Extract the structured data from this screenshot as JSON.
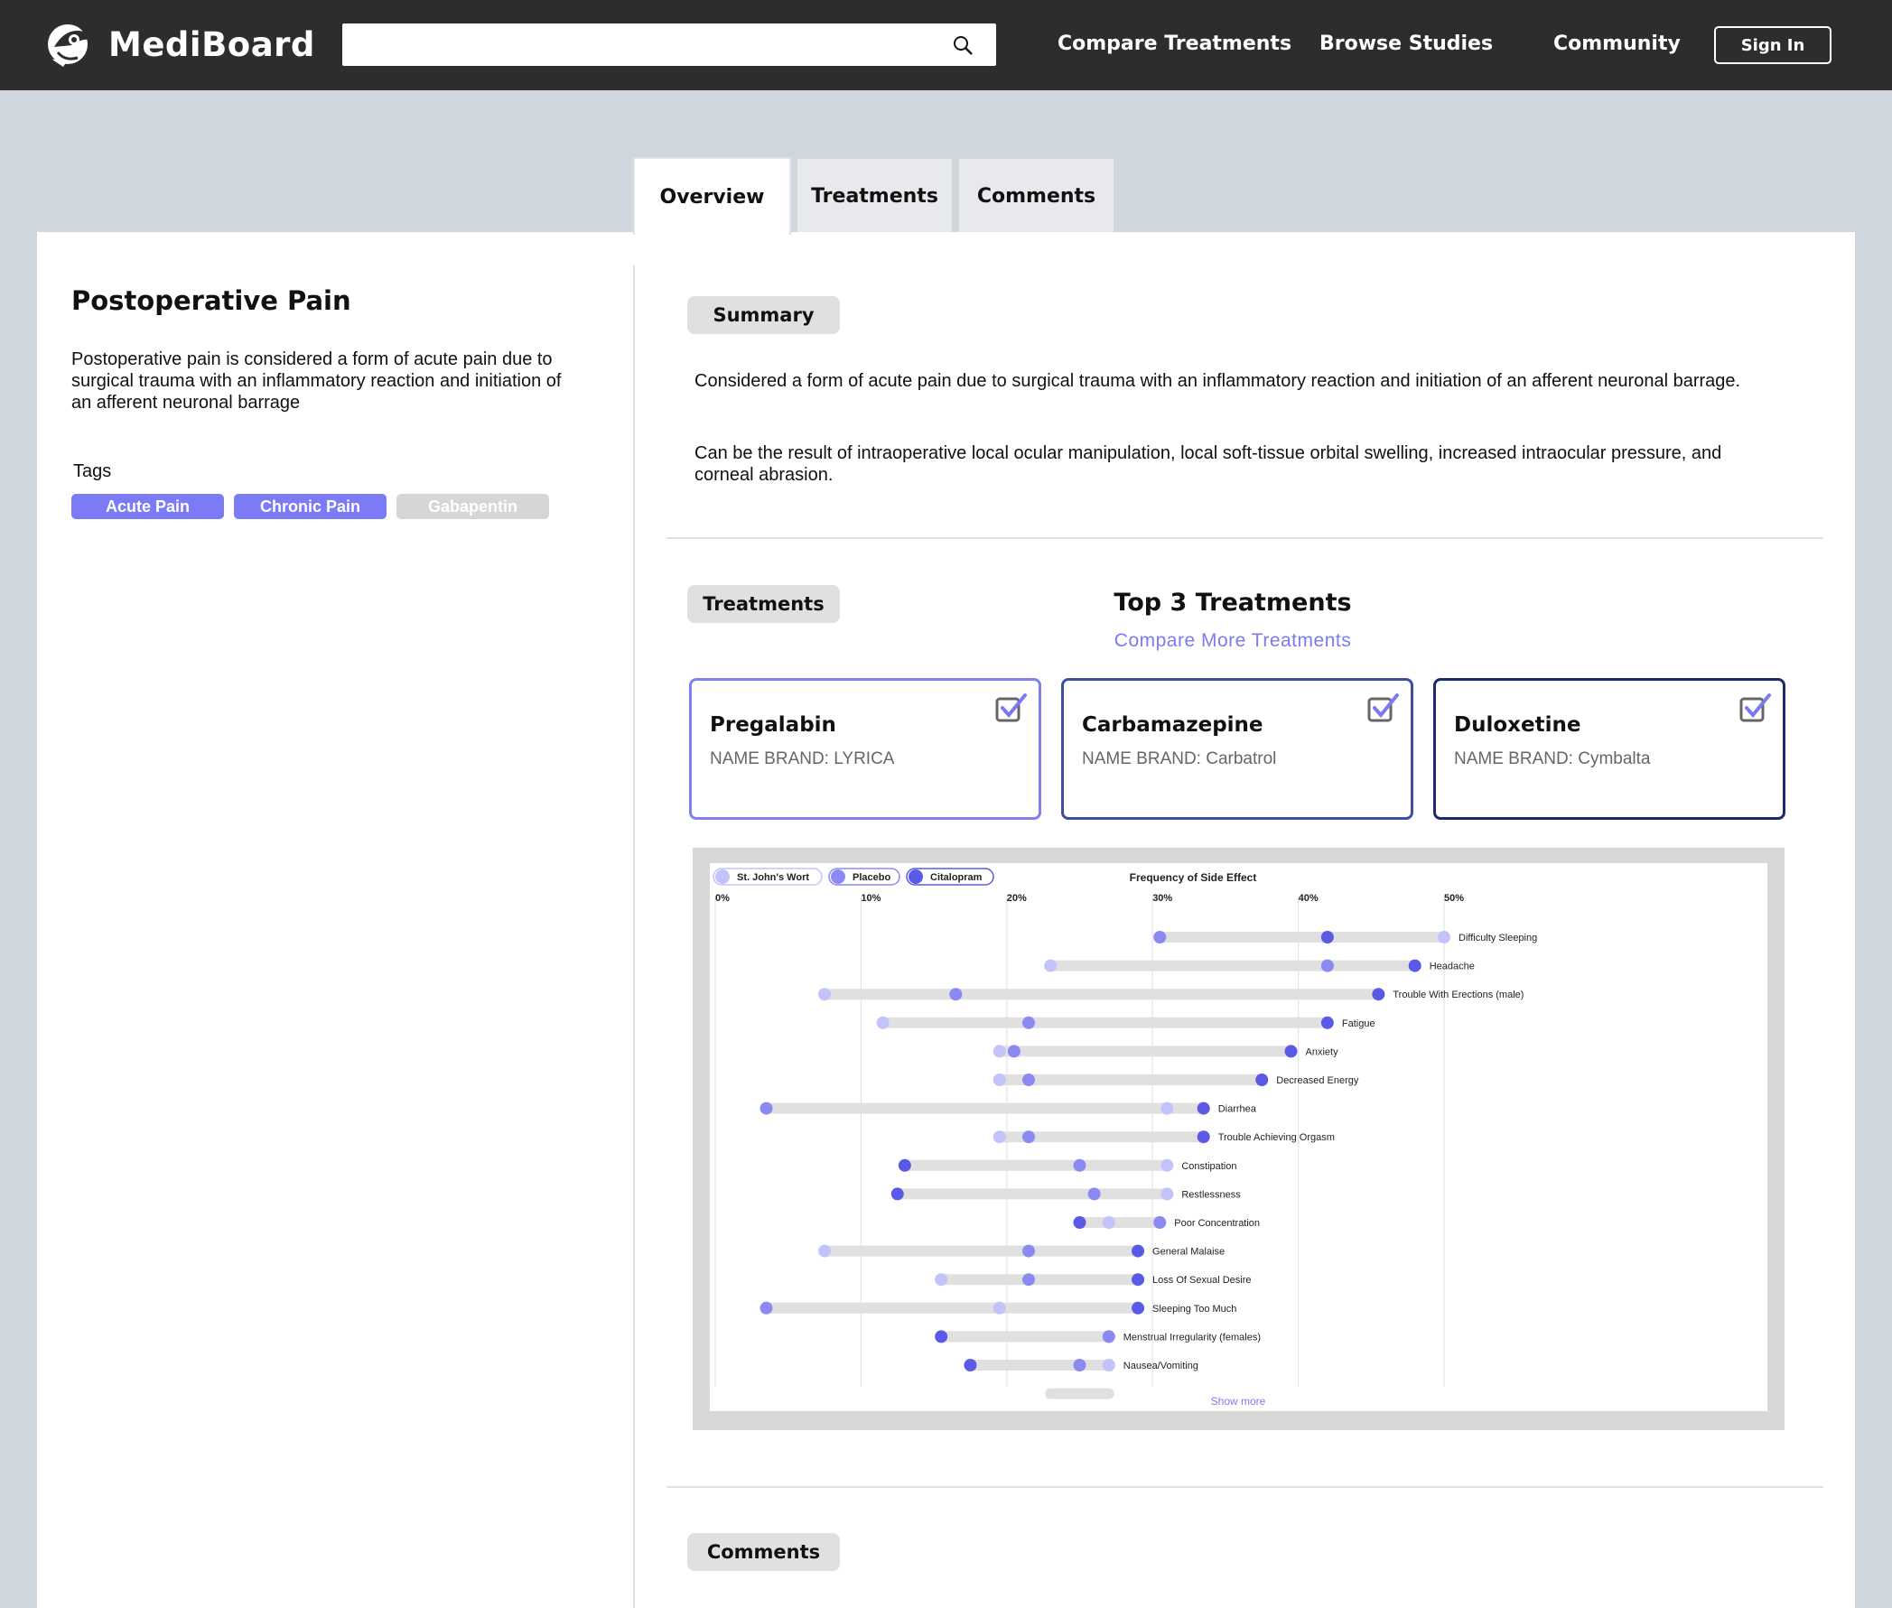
{
  "header": {
    "brand": "MediBoard",
    "search_placeholder": "",
    "nav": [
      "Compare Treatments",
      "Browse Studies",
      "Community"
    ],
    "sign_in": "Sign In"
  },
  "tabs": [
    "Overview",
    "Treatments",
    "Comments"
  ],
  "condition": {
    "title": "Postoperative Pain",
    "description": "Postoperative pain is considered a form of acute pain due to surgical trauma with an inflammatory reaction and initiation of an afferent neuronal barrage",
    "tags_label": "Tags",
    "tags": [
      {
        "label": "Acute Pain",
        "color": "#7b7bf5"
      },
      {
        "label": "Chronic Pain",
        "color": "#7b7bf5"
      },
      {
        "label": "Gabapentin",
        "color": "#d6d6d6"
      }
    ]
  },
  "summary": {
    "label": "Summary",
    "paragraphs": [
      "Considered a form of acute pain due to surgical trauma with an inflammatory reaction and initiation of an afferent neuronal barrage.",
      "Can be the result of intraoperative local ocular manipulation, local soft-tissue orbital swelling, increased intraocular pressure, and corneal abrasion."
    ]
  },
  "treatments": {
    "label": "Treatments",
    "heading": "Top 3 Treatments",
    "compare_link": "Compare More Treatments",
    "cards": [
      {
        "name": "Pregalabin",
        "brand": "NAME BRAND: LYRICA",
        "border": "#8080ee"
      },
      {
        "name": "Carbamazepine",
        "brand": "NAME BRAND: Carbatrol",
        "border": "#3d4f9e"
      },
      {
        "name": "Duloxetine",
        "brand": "NAME BRAND: Cymbalta",
        "border": "#1c2a6e"
      }
    ]
  },
  "comments": {
    "label": "Comments"
  },
  "chart_data": {
    "type": "scatter",
    "title": "Frequency of Side Effect",
    "x_ticks": [
      "0%",
      "10%",
      "20%",
      "30%",
      "40%",
      "50%"
    ],
    "xlim": [
      0,
      50
    ],
    "show_more": "Show more",
    "series": [
      {
        "name": "St. John's Wort",
        "color": "#c3c3fb"
      },
      {
        "name": "Placebo",
        "color": "#8a8af2"
      },
      {
        "name": "Citalopram",
        "color": "#5a5ae6"
      }
    ],
    "rows": [
      {
        "label": "Difficulty Sleeping",
        "values": [
          50,
          30.5,
          42
        ]
      },
      {
        "label": "Headache",
        "values": [
          23,
          42,
          48
        ]
      },
      {
        "label": "Trouble With Erections (male)",
        "values": [
          7.5,
          16.5,
          45.5
        ]
      },
      {
        "label": "Fatigue",
        "values": [
          11.5,
          21.5,
          42
        ]
      },
      {
        "label": "Anxiety",
        "values": [
          19.5,
          20.5,
          39.5
        ]
      },
      {
        "label": "Decreased Energy",
        "values": [
          19.5,
          21.5,
          37.5
        ]
      },
      {
        "label": "Diarrhea",
        "values": [
          31,
          3.5,
          33.5
        ]
      },
      {
        "label": "Trouble Achieving Orgasm",
        "values": [
          19.5,
          21.5,
          33.5
        ]
      },
      {
        "label": "Constipation",
        "values": [
          31,
          25,
          13
        ]
      },
      {
        "label": "Restlessness",
        "values": [
          31,
          26,
          12.5
        ]
      },
      {
        "label": "Poor Concentration",
        "values": [
          27,
          30.5,
          25
        ]
      },
      {
        "label": "General Malaise",
        "values": [
          7.5,
          21.5,
          29
        ]
      },
      {
        "label": "Loss Of Sexual Desire",
        "values": [
          15.5,
          21.5,
          29
        ]
      },
      {
        "label": "Sleeping Too Much",
        "values": [
          19.5,
          3.5,
          29
        ]
      },
      {
        "label": "Menstrual Irregularity (females)",
        "values": [
          27,
          27,
          15.5
        ]
      },
      {
        "label": "Nausea/Vomiting",
        "values": [
          27,
          25,
          17.5
        ]
      }
    ]
  }
}
